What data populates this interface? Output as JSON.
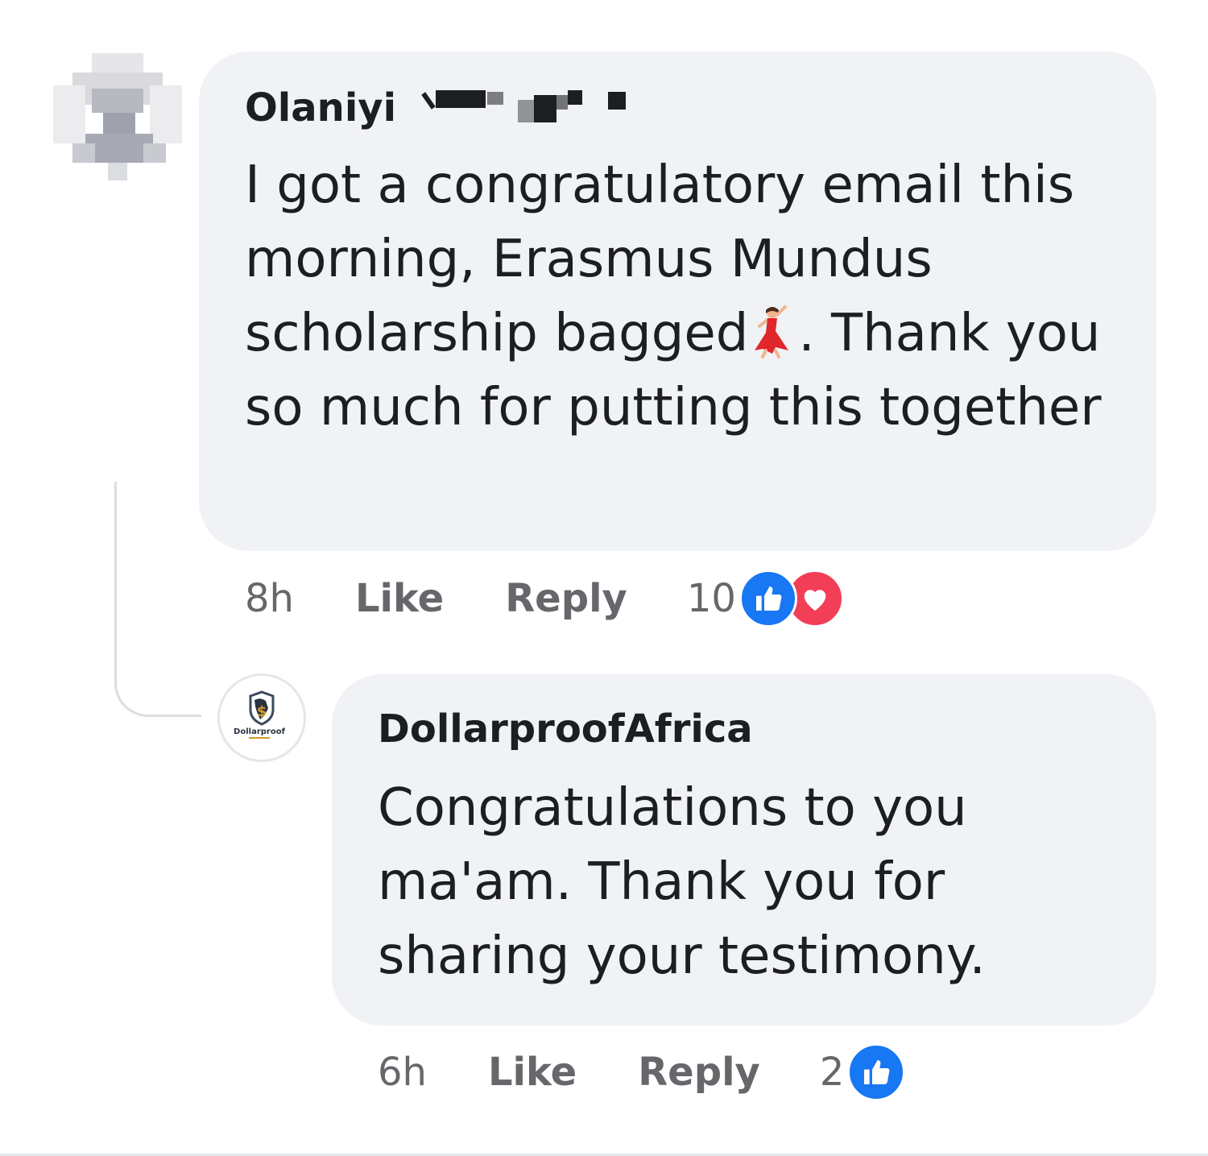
{
  "comment": {
    "author": "Olaniyi",
    "text_before_emoji": "I got a congratulatory email this morning, Erasmus Mundus scholarship bagged",
    "emoji": "dancing-woman-emoji",
    "text_after_emoji": ". Thank you so much for putting this together",
    "time": "8h",
    "like_label": "Like",
    "reply_label": "Reply",
    "reaction_count": "10",
    "reactions": [
      "like-icon",
      "love-icon"
    ]
  },
  "reply": {
    "author": "DollarproofAfrica",
    "avatar_logo_text": "Dollarproof",
    "text": "Congratulations to you ma'am. Thank you for sharing your testimony.",
    "time": "6h",
    "like_label": "Like",
    "reply_label": "Reply",
    "reaction_count": "2",
    "reactions": [
      "like-icon"
    ]
  },
  "colors": {
    "bubble": "#f0f2f5",
    "text": "#1c1e21",
    "meta": "#65676b",
    "like_blue": "#1877f2",
    "love_red": "#f33e58"
  }
}
